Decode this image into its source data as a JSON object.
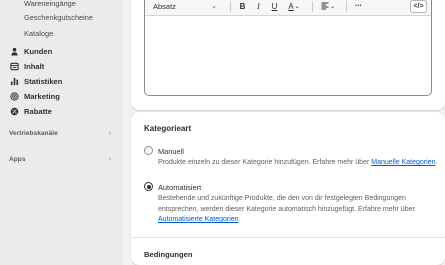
{
  "sidebar": {
    "sub_items": [
      "Wareneingänge",
      "Geschenkgutscheine",
      "Kataloge"
    ],
    "nav_items": [
      {
        "label": "Kunden",
        "icon": "person-icon"
      },
      {
        "label": "Inhalt",
        "icon": "content-icon"
      },
      {
        "label": "Statistiken",
        "icon": "bar-chart-icon"
      },
      {
        "label": "Marketing",
        "icon": "target-icon"
      },
      {
        "label": "Rabatte",
        "icon": "discount-icon"
      }
    ],
    "sections": [
      {
        "label": "Vertriebskanäle",
        "chevron": "›"
      },
      {
        "label": "Apps",
        "chevron": "›"
      }
    ]
  },
  "editor": {
    "format_select": "Absatz",
    "bold": "B",
    "italic": "I",
    "underline": "U",
    "text_color": "A",
    "more": "•••",
    "code": "</>"
  },
  "category_type": {
    "title": "Kategorieart",
    "options": [
      {
        "label": "Manuell",
        "selected": false,
        "help_text": "Produkte einzeln zu dieser Kategorie hinzufügen. Erfahre mehr über ",
        "link_text": "Manuelle Kategorien",
        "help_suffix": "."
      },
      {
        "label": "Automatisiert",
        "selected": true,
        "help_text": "Bestehende und zukünftige Produkte, die den von dir festgelegten Bedingungen entsprechen, werden dieser Kategorie automatisch hinzugefügt. Erfahre mehr über ",
        "link_text": "Automatisierte Kategorien",
        "help_suffix": "."
      }
    ]
  },
  "conditions": {
    "title": "Bedingungen"
  },
  "colors": {
    "sidebar_bg": "#ebebeb",
    "page_bg": "#f1f1f1",
    "link": "#005bd3"
  }
}
